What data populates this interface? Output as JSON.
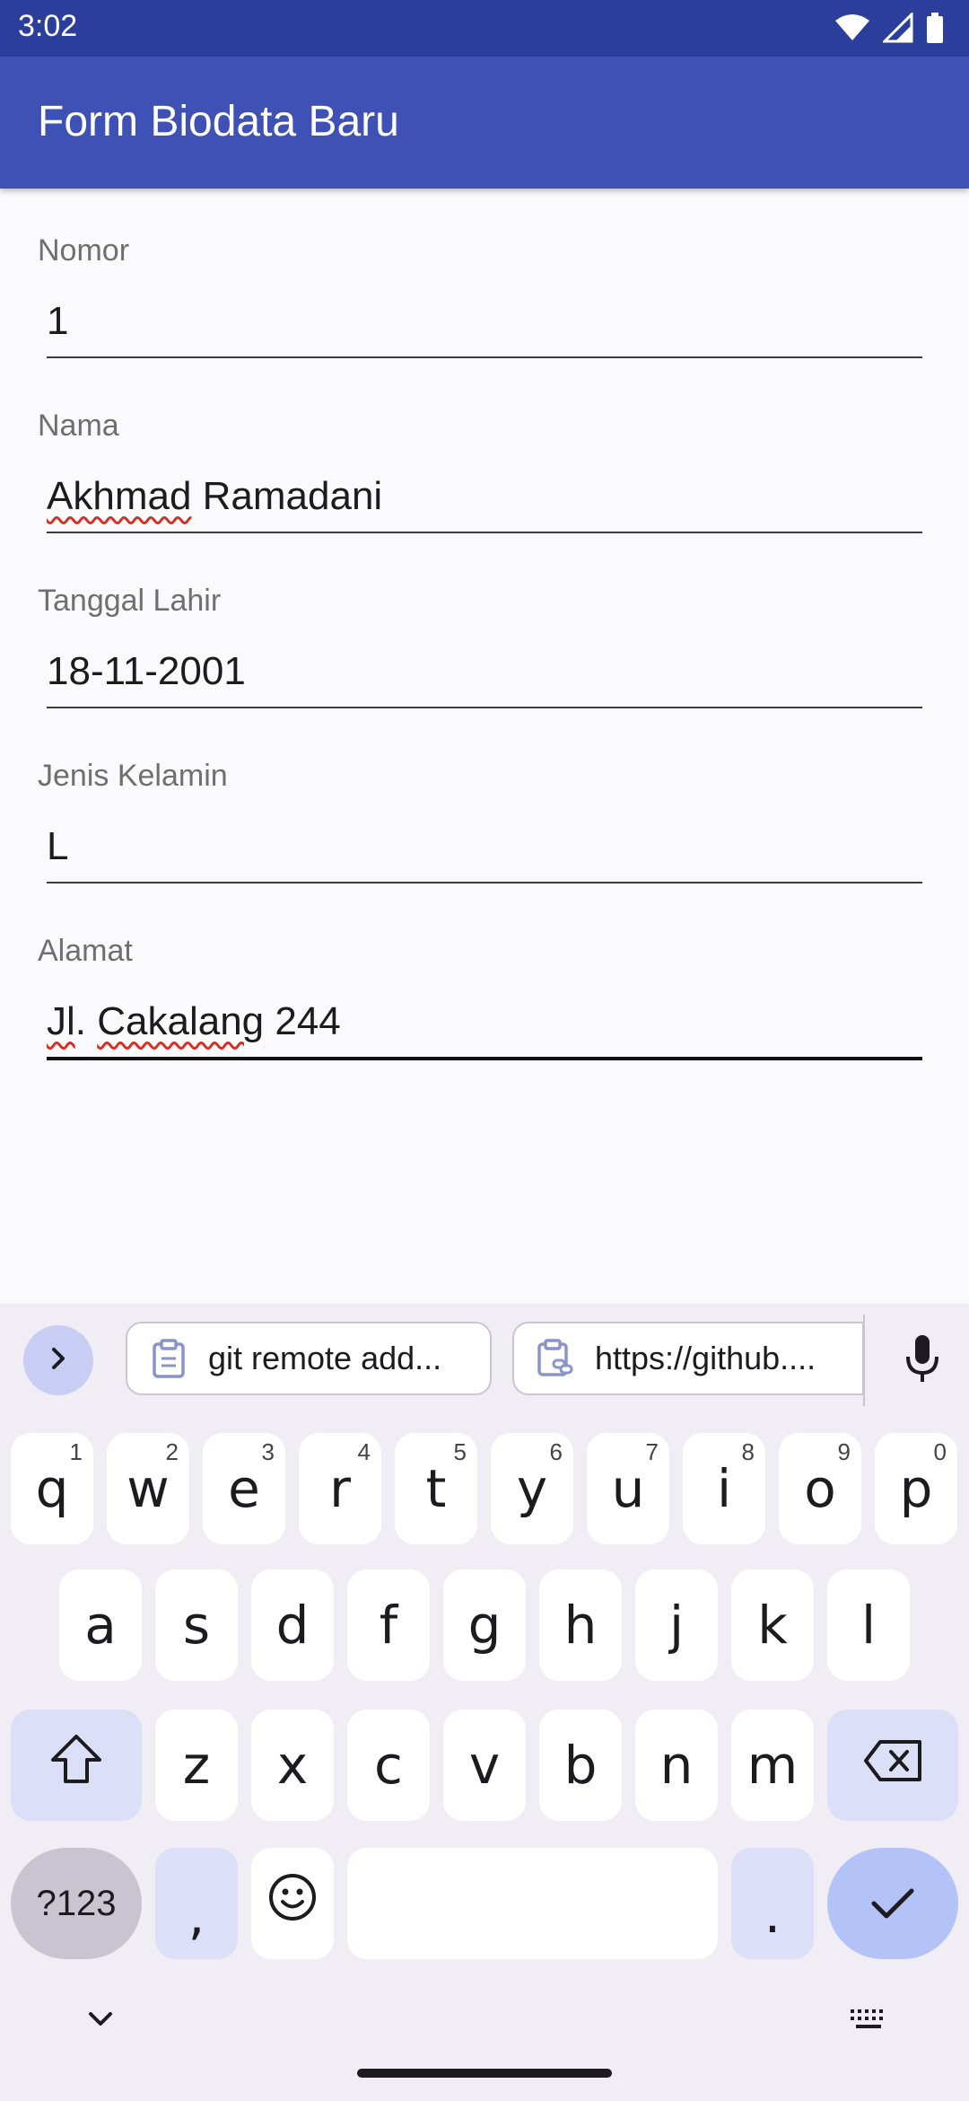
{
  "status_bar": {
    "time": "3:02",
    "icons": [
      "wifi-icon",
      "signal-icon",
      "battery-icon"
    ]
  },
  "app_bar": {
    "title": "Form Biodata Baru",
    "color": "#3f51b5"
  },
  "form": {
    "fields": [
      {
        "label": "Nomor",
        "value": "1"
      },
      {
        "label": "Nama",
        "value_part1": "Akhmad",
        "value_part2": " Ramadani"
      },
      {
        "label": "Tanggal Lahir",
        "value": "18-11-2001"
      },
      {
        "label": "Jenis Kelamin",
        "value": "L"
      },
      {
        "label": "Alamat",
        "value_part1": "Jl",
        "value_part2": ". ",
        "value_part3": "Cakalang",
        "value_part4": " 244"
      }
    ]
  },
  "keyboard": {
    "suggestions": [
      {
        "icon": "clipboard-icon",
        "text": "git remote add..."
      },
      {
        "icon": "clipboard-link-icon",
        "text": "https://github...."
      }
    ],
    "row1": [
      {
        "key": "q",
        "hint": "1"
      },
      {
        "key": "w",
        "hint": "2"
      },
      {
        "key": "e",
        "hint": "3"
      },
      {
        "key": "r",
        "hint": "4"
      },
      {
        "key": "t",
        "hint": "5"
      },
      {
        "key": "y",
        "hint": "6"
      },
      {
        "key": "u",
        "hint": "7"
      },
      {
        "key": "i",
        "hint": "8"
      },
      {
        "key": "o",
        "hint": "9"
      },
      {
        "key": "p",
        "hint": "0"
      }
    ],
    "row2": [
      "a",
      "s",
      "d",
      "f",
      "g",
      "h",
      "j",
      "k",
      "l"
    ],
    "row3": [
      "z",
      "x",
      "c",
      "v",
      "b",
      "n",
      "m"
    ],
    "symbols_label": "?123",
    "comma": ",",
    "period": ".",
    "accent_color": "#b3c2f7"
  }
}
